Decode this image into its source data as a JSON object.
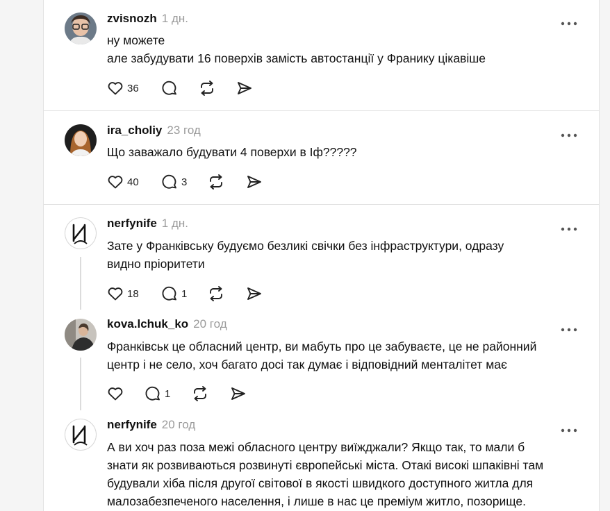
{
  "posts": [
    {
      "username": "zvisnozh",
      "time": "1 дн.",
      "lines": [
        "ну можете",
        "але забудувати 16 поверхів замість автостанції у Франику цікавіше"
      ],
      "likes": "36",
      "replies": "",
      "avatar": "avatar-photo-glasses"
    },
    {
      "username": "ira_choliy",
      "time": "23 год",
      "lines": [
        "Що заважало будувати 4 поверхи в Іф?????"
      ],
      "likes": "40",
      "replies": "3",
      "avatar": "avatar-photo-woman"
    },
    {
      "username": "nerfynife",
      "time": "1 дн.",
      "lines": [
        "Зате у Франківську будуємо безликі свічки без інфраструктури, одразу",
        "видно пріоритети"
      ],
      "likes": "18",
      "replies": "1",
      "avatar": "avatar-logo-letter-i"
    },
    {
      "username": "kova.lchuk_ko",
      "time": "20 год",
      "lines": [
        "Франківськ це обласний центр, ви мабуть про це забуваєте, це не районний",
        "центр і не село, хоч багато досі так думає і відповідний менталітет має"
      ],
      "likes": "",
      "replies": "1",
      "avatar": "avatar-photo-person"
    },
    {
      "username": "nerfynife",
      "time": "20 год",
      "lines": [
        "А ви хоч раз поза межі обласного центру виїжджали? Якщо так, то мали б",
        "знати як розвиваються розвинуті європейські міста. Отакі високі шпаківні там",
        "будували хіба після другої світової в якості швидкого доступного житла для",
        "малозабезпеченого населення, і лише в нас це преміум житло, позорище."
      ],
      "likes": "",
      "replies": "",
      "avatar": "avatar-logo-letter-i"
    }
  ],
  "icons": {
    "like": "heart-icon",
    "reply": "comment-icon",
    "repost": "repost-icon",
    "share": "send-icon",
    "more": "more-dots-icon"
  }
}
